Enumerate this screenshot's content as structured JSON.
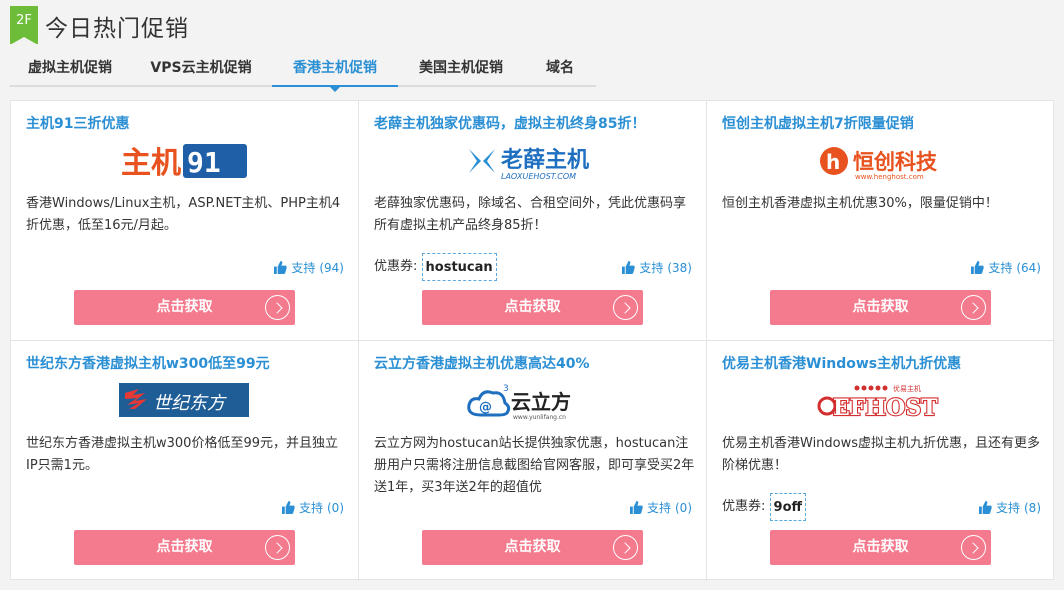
{
  "header": {
    "floor_badge": "2F",
    "title": "今日热门促销"
  },
  "tabs": [
    {
      "label": "虚拟主机促销",
      "active": false
    },
    {
      "label": "VPS云主机促销",
      "active": false
    },
    {
      "label": "香港主机促销",
      "active": true
    },
    {
      "label": "美国主机促销",
      "active": false
    },
    {
      "label": "域名",
      "active": false
    }
  ],
  "coupon_label": "优惠券:",
  "support_label": "支持",
  "button_label": "点击获取",
  "cards": [
    {
      "title": "主机91三折优惠",
      "logo": {
        "text": "主机",
        "text2": "91"
      },
      "desc": "香港Windows/Linux主机，ASP.NET主机、PHP主机4折优惠，低至16元/月起。",
      "coupon": "",
      "support_count": "(94)"
    },
    {
      "title": "老薛主机独家优惠码，虚拟主机终身85折！",
      "logo": {
        "text": "老薛主机",
        "sub": "LAOXUEHOST.COM"
      },
      "desc": "老薛独家优惠码，除域名、合租空间外，凭此优惠码享所有虚拟主机产品终身85折！",
      "coupon": "hostucan",
      "support_count": "(38)"
    },
    {
      "title": "恒创主机虚拟主机7折限量促销",
      "logo": {
        "text": "恒创科技",
        "sub": "www.henghost.com"
      },
      "desc": "恒创主机香港虚拟主机优惠30%，限量促销中！",
      "coupon": "",
      "support_count": "(64)"
    },
    {
      "title": "世纪东方香港虚拟主机w300低至99元",
      "logo": {
        "text": "世纪东方"
      },
      "desc": "世纪东方香港虚拟主机w300价格低至99元，并且独立IP只需1元。",
      "coupon": "",
      "support_count": "(0)"
    },
    {
      "title": "云立方香港虚拟主机优惠高达40%",
      "logo": {
        "text": "云立方",
        "sub": "www.yunlifang.cn"
      },
      "desc": "云立方网为hostucan站长提供独家优惠，hostucan注册用户只需将注册信息截图给官网客服，即可享受买2年送1年，买3年送2年的超值优",
      "coupon": "",
      "support_count": "(0)"
    },
    {
      "title": "优易主机香港Windows主机九折优惠",
      "logo": {
        "text": "EFHOST",
        "sub": "优易主机"
      },
      "desc": "优易主机香港Windows虚拟主机九折优惠，且还有更多阶梯优惠！",
      "coupon": "9off",
      "support_count": "(8)"
    }
  ],
  "colors": {
    "accent": "#2a8fd4",
    "button": "#f47a8d",
    "badge": "#6ebd3a"
  }
}
